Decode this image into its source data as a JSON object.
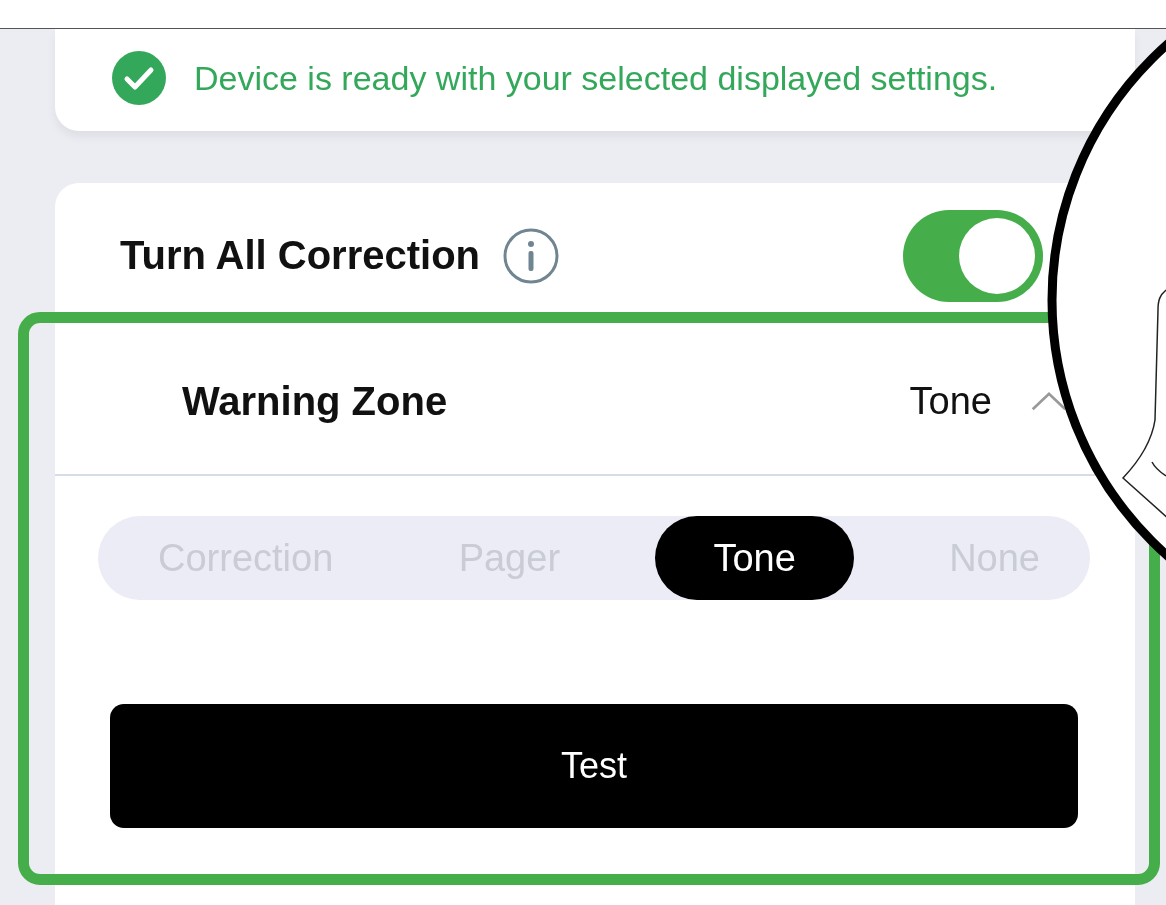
{
  "status_message": {
    "text": "Device is ready with your selected displayed settings."
  },
  "correction_toggle": {
    "label": "Turn All Correction",
    "on": true
  },
  "warning_zone": {
    "title": "Warning Zone",
    "value": "Tone",
    "expanded": true,
    "options": [
      {
        "label": "Correction",
        "selected": false
      },
      {
        "label": "Pager",
        "selected": false
      },
      {
        "label": "Tone",
        "selected": true
      },
      {
        "label": "None",
        "selected": false
      }
    ],
    "test_button": "Test"
  }
}
